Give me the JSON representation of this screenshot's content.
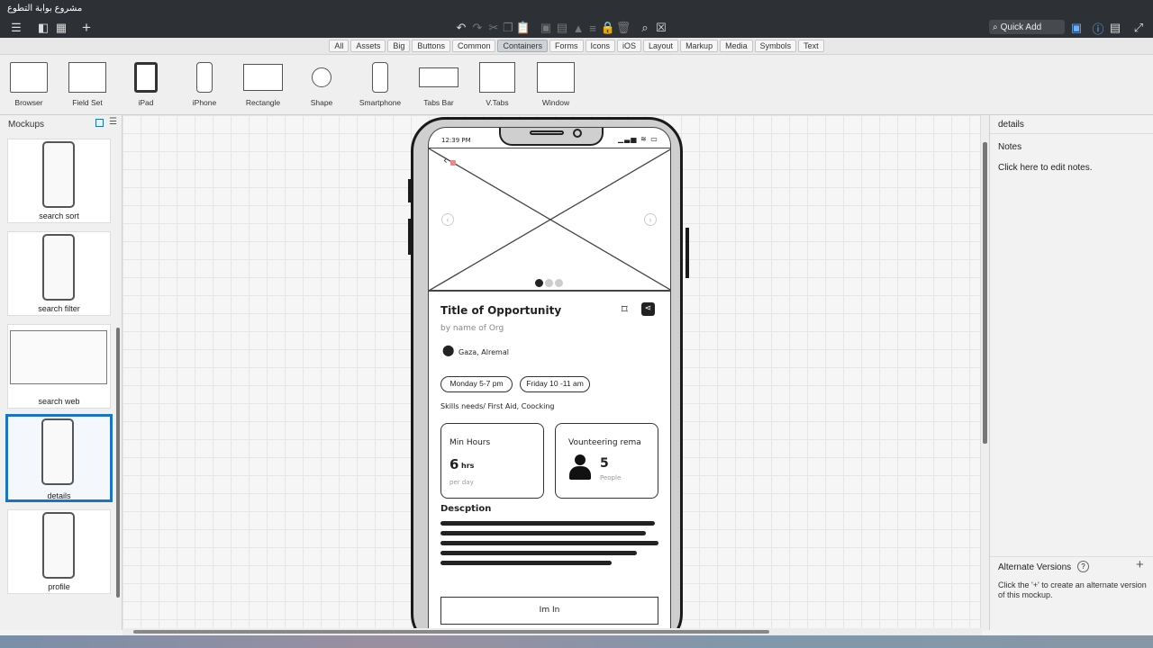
{
  "window": {
    "title": "مشروع بوابة التطوع"
  },
  "toolbar": {
    "quick_add_label": "Quick Add"
  },
  "categories": [
    "All",
    "Assets",
    "Big",
    "Buttons",
    "Common",
    "Containers",
    "Forms",
    "Icons",
    "iOS",
    "Layout",
    "Markup",
    "Media",
    "Symbols",
    "Text"
  ],
  "active_category": "Containers",
  "components": [
    "Browser",
    "Field Set",
    "iPad",
    "iPhone",
    "Rectangle",
    "Shape",
    "Smartphone",
    "Tabs Bar",
    "V.Tabs",
    "Window"
  ],
  "mockups_panel": {
    "title": "Mockups",
    "items": [
      "search sort",
      "search filter",
      "search web",
      "details",
      "profile"
    ],
    "selected": "details"
  },
  "right_panel": {
    "title": "details",
    "notes_label": "Notes",
    "notes_hint": "Click here to edit notes.",
    "alt_versions_label": "Alternate Versions",
    "alt_versions_hint": "Click the '+' to create an alternate version of this mockup."
  },
  "phone": {
    "time": "12:39 PM",
    "title": "Title of Opportunity",
    "org": "by name of Org",
    "location": "Gaza, Alremal",
    "slots": [
      "Monday 5-7 pm",
      "Friday 10 -11 am"
    ],
    "skills": "Skills needs/ First Aid, Coocking",
    "card1": {
      "title": "Min Hours",
      "value": "6",
      "unit": "hrs",
      "sub": "per day"
    },
    "card2": {
      "title": "Vounteering rema",
      "value": "5",
      "sub": "People"
    },
    "description_title": "Descption",
    "button_label": "Im In"
  }
}
